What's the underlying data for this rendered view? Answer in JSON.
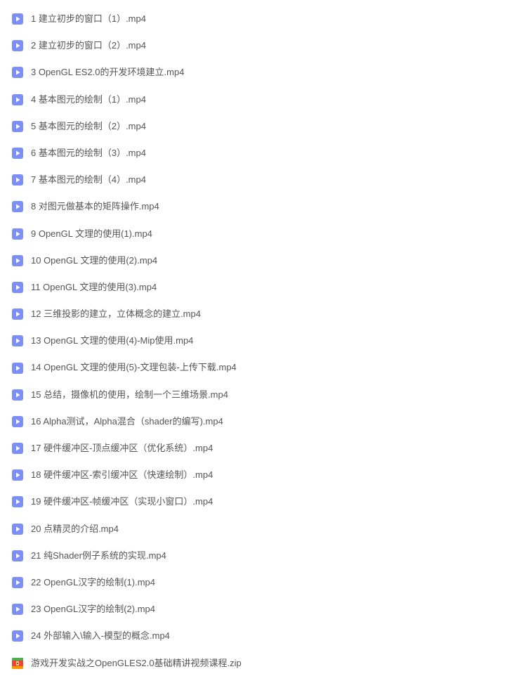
{
  "files": [
    {
      "name": "1 建立初步的窗口（1）.mp4",
      "type": "video"
    },
    {
      "name": "2 建立初步的窗口（2）.mp4",
      "type": "video"
    },
    {
      "name": "3 OpenGL ES2.0的开发环境建立.mp4",
      "type": "video"
    },
    {
      "name": "4 基本图元的绘制（1）.mp4",
      "type": "video"
    },
    {
      "name": "5 基本图元的绘制（2）.mp4",
      "type": "video"
    },
    {
      "name": "6 基本图元的绘制（3）.mp4",
      "type": "video"
    },
    {
      "name": "7 基本图元的绘制（4）.mp4",
      "type": "video"
    },
    {
      "name": "8 对图元做基本的矩阵操作.mp4",
      "type": "video"
    },
    {
      "name": "9 OpenGL 文理的使用(1).mp4",
      "type": "video"
    },
    {
      "name": "10 OpenGL 文理的使用(2).mp4",
      "type": "video"
    },
    {
      "name": "11 OpenGL 文理的使用(3).mp4",
      "type": "video"
    },
    {
      "name": "12 三维投影的建立，立体概念的建立.mp4",
      "type": "video"
    },
    {
      "name": "13 OpenGL 文理的使用(4)-Mip使用.mp4",
      "type": "video"
    },
    {
      "name": "14 OpenGL 文理的使用(5)-文理包装-上传下载.mp4",
      "type": "video"
    },
    {
      "name": "15 总结，摄像机的使用，绘制一个三维场景.mp4",
      "type": "video"
    },
    {
      "name": "16 Alpha测试，Alpha混合（shader的编写).mp4",
      "type": "video"
    },
    {
      "name": "17 硬件缓冲区-顶点缓冲区（优化系统）.mp4",
      "type": "video"
    },
    {
      "name": "18 硬件缓冲区-索引缓冲区（快速绘制）.mp4",
      "type": "video"
    },
    {
      "name": "19 硬件缓冲区-帧缓冲区（实现小窗口）.mp4",
      "type": "video"
    },
    {
      "name": "20 点精灵的介绍.mp4",
      "type": "video"
    },
    {
      "name": "21 纯Shader例子系统的实现.mp4",
      "type": "video"
    },
    {
      "name": "22 OpenGL汉字的绘制(1).mp4",
      "type": "video"
    },
    {
      "name": "23 OpenGL汉字的绘制(2).mp4",
      "type": "video"
    },
    {
      "name": "24 外部输入\\输入-模型的概念.mp4",
      "type": "video"
    },
    {
      "name": "游戏开发实战之OpenGLES2.0基础精讲视频课程.zip",
      "type": "zip"
    }
  ],
  "icons": {
    "video": "video-file-icon",
    "zip": "zip-file-icon"
  }
}
